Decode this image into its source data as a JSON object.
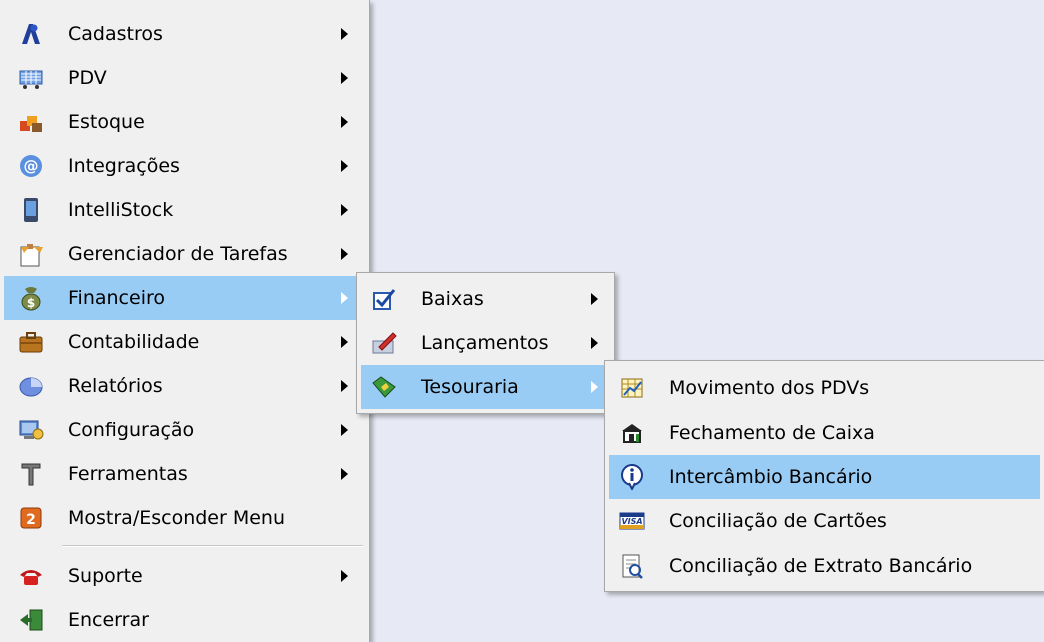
{
  "main_menu": {
    "items": [
      {
        "label": "Cadastros",
        "icon": "cadastros-icon",
        "submenu": true
      },
      {
        "label": "PDV",
        "icon": "pdv-icon",
        "submenu": true
      },
      {
        "label": "Estoque",
        "icon": "estoque-icon",
        "submenu": true
      },
      {
        "label": "Integrações",
        "icon": "integracoes-icon",
        "submenu": true
      },
      {
        "label": "IntelliStock",
        "icon": "intellistock-icon",
        "submenu": true
      },
      {
        "label": "Gerenciador de Tarefas",
        "icon": "tarefas-icon",
        "submenu": true
      },
      {
        "label": "Financeiro",
        "icon": "financeiro-icon",
        "submenu": true,
        "highlighted": true
      },
      {
        "label": "Contabilidade",
        "icon": "contabilidade-icon",
        "submenu": true
      },
      {
        "label": "Relatórios",
        "icon": "relatorios-icon",
        "submenu": true
      },
      {
        "label": "Configuração",
        "icon": "configuracao-icon",
        "submenu": true
      },
      {
        "label": "Ferramentas",
        "icon": "ferramentas-icon",
        "submenu": true
      },
      {
        "label": "Mostra/Esconder Menu",
        "icon": "mostra-esconder-icon",
        "submenu": false
      },
      {
        "label": "Suporte",
        "icon": "suporte-icon",
        "submenu": true
      },
      {
        "label": "Encerrar",
        "icon": "encerrar-icon",
        "submenu": false
      }
    ]
  },
  "financeiro_menu": {
    "items": [
      {
        "label": "Baixas",
        "icon": "baixas-icon",
        "submenu": true
      },
      {
        "label": "Lançamentos",
        "icon": "lancamentos-icon",
        "submenu": true
      },
      {
        "label": "Tesouraria",
        "icon": "tesouraria-icon",
        "submenu": true,
        "highlighted": true
      }
    ]
  },
  "tesouraria_menu": {
    "items": [
      {
        "label": "Movimento dos PDVs",
        "icon": "movimento-pdvs-icon"
      },
      {
        "label": "Fechamento de Caixa",
        "icon": "fechamento-caixa-icon"
      },
      {
        "label": "Intercâmbio Bancário",
        "icon": "info-icon",
        "highlighted": true
      },
      {
        "label": "Conciliação de Cartões",
        "icon": "visa-card-icon"
      },
      {
        "label": "Conciliação de Extrato Bancário",
        "icon": "extrato-icon"
      }
    ]
  },
  "colors": {
    "highlight": "#99ccf5",
    "menu_bg": "#f0f0f0",
    "desktop_bg": "#e7eaf5"
  }
}
